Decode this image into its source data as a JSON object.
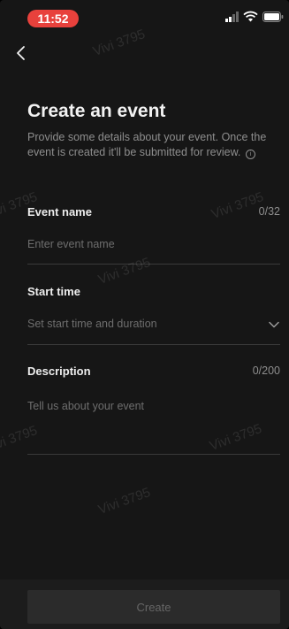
{
  "status_bar": {
    "time": "11:52"
  },
  "header": {
    "title": "Create an event",
    "subtitle": "Provide some details about your event. Once the event is created it'll be submitted for review."
  },
  "form": {
    "event_name": {
      "label": "Event name",
      "counter": "0/32",
      "placeholder": "Enter event name"
    },
    "start_time": {
      "label": "Start time",
      "placeholder": "Set start time and duration"
    },
    "description": {
      "label": "Description",
      "counter": "0/200",
      "placeholder": "Tell us about your event"
    }
  },
  "footer": {
    "create_label": "Create"
  },
  "watermark": "Vivi 3795",
  "icons": [
    "back-arrow-icon",
    "info-icon",
    "chevron-down-icon",
    "signal-icon",
    "wifi-icon",
    "battery-icon"
  ],
  "colors": {
    "background": "#161616",
    "time_pill": "#e8413c",
    "text": "#f2f2f2",
    "muted": "#8e8e8e"
  }
}
